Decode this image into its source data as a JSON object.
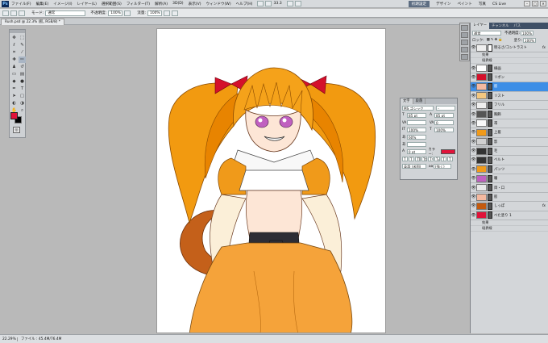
{
  "menubar": {
    "app_logo": "Ps",
    "items": [
      "ファイル(F)",
      "編集(E)",
      "イメージ(I)",
      "レイヤー(L)",
      "選択範囲(S)",
      "フィルター(T)",
      "解析(A)",
      "3D(D)",
      "表示(V)",
      "ウィンドウ(W)",
      "ヘルプ(H)"
    ],
    "zoom_readout": "33.3",
    "workspaces": [
      "初期設定",
      "デザイン",
      "ペイント",
      "写真",
      "CS Live"
    ]
  },
  "options": {
    "mode_label": "モード:",
    "mode_value": "通常",
    "opacity_label": "不透明度:",
    "opacity_value": "100%",
    "flow_label": "流量:",
    "flow_value": "100%"
  },
  "document": {
    "tab_title": "Rush.psd @ 22.3% (肌, RGB/8) *"
  },
  "status": {
    "zoom": "22.29%",
    "info": "ファイル : 45.4M/76.4M"
  },
  "character_panel": {
    "tabs": [
      "文字",
      "段落"
    ],
    "font_family": "MS ゴシック",
    "font_style": "-",
    "font_size": "85 pt",
    "leading": "85 pt",
    "tracking_label": "VA",
    "tracking_value": "0",
    "vscale": "100%",
    "hscale": "100%",
    "tsume": "60%",
    "baseline": "0 pt",
    "color_label": "カラー:",
    "color": "#e0133a",
    "language": "英語 (米国)",
    "antialias": "(強く)"
  },
  "layers_panel": {
    "tabs": [
      "レイヤー",
      "チャンネル",
      "パス"
    ],
    "blend_mode": "通常",
    "opacity_label": "不透明度:",
    "opacity_value": "100%",
    "lock_label": "ロック:",
    "fill_label": "塗り:",
    "fill_value": "100%",
    "top_layer": "明るさ/コントラスト",
    "effects_label": "効果",
    "stroke_label": "境界線",
    "fx": "fx",
    "layers": [
      {
        "name": "線画",
        "color": "#ffffff"
      },
      {
        "name": "リボン",
        "color": "#d4102b"
      },
      {
        "name": "肌",
        "color": "#f4b9a0"
      },
      {
        "name": "リスト",
        "color": "#f4c77f"
      },
      {
        "name": "フリル",
        "color": "#eeeeee"
      },
      {
        "name": "胸飾",
        "color": "#555555"
      },
      {
        "name": "帯",
        "color": "#f8f8f8"
      },
      {
        "name": "上着",
        "color": "#f09a1a"
      },
      {
        "name": "影",
        "color": "#d0d0d0"
      },
      {
        "name": "毛",
        "color": "#333333"
      },
      {
        "name": "ベルト",
        "color": "#333333"
      },
      {
        "name": "パンツ",
        "color": "#f09a1a"
      },
      {
        "name": "瞳",
        "color": "#c060c0"
      },
      {
        "name": "目・口",
        "color": "#e8e8e8"
      },
      {
        "name": "肌",
        "color": "#f4b9a0"
      },
      {
        "name": "しっぽ",
        "color": "#c45a0e"
      },
      {
        "name": "べた塗り 1",
        "color": "#e0133a"
      }
    ]
  },
  "tool_colors": {
    "foreground": "#e0133a",
    "background": "#000000"
  }
}
